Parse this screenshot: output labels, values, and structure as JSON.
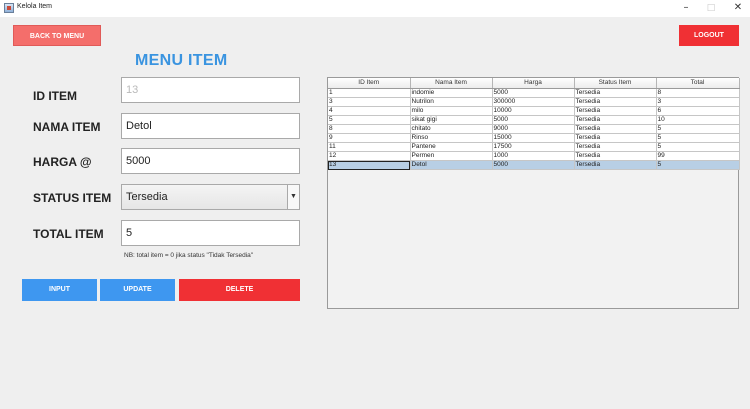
{
  "window": {
    "title": "Kelola Item"
  },
  "header": {
    "back_label": "BACK TO MENU",
    "logout_label": "LOGOUT",
    "page_title": "MENU ITEM"
  },
  "form": {
    "id_label": "ID ITEM",
    "id_value": "13",
    "name_label": "NAMA ITEM",
    "name_value": "Detol",
    "price_label": "HARGA @",
    "price_value": "5000",
    "status_label": "STATUS ITEM",
    "status_value": "Tersedia",
    "total_label": "TOTAL ITEM",
    "total_value": "5",
    "note": "NB: total item = 0 jika status \"Tidak Tersedia\""
  },
  "actions": {
    "input_label": "INPUT",
    "update_label": "UPDATE",
    "delete_label": "DELETE"
  },
  "table": {
    "columns": [
      "ID Item",
      "Nama Item",
      "Harga",
      "Status Item",
      "Total"
    ],
    "rows": [
      [
        "1",
        "indomie",
        "5000",
        "Tersedia",
        "8"
      ],
      [
        "3",
        "Nutrilon",
        "300000",
        "Tersedia",
        "3"
      ],
      [
        "4",
        "milo",
        "10000",
        "Tersedia",
        "6"
      ],
      [
        "5",
        "sikat gigi",
        "5000",
        "Tersedia",
        "10"
      ],
      [
        "8",
        "chitato",
        "9000",
        "Tersedia",
        "5"
      ],
      [
        "9",
        "Rinso",
        "15000",
        "Tersedia",
        "5"
      ],
      [
        "11",
        "Pantene",
        "17500",
        "Tersedia",
        "5"
      ],
      [
        "12",
        "Permen",
        "1000",
        "Tersedia",
        "99"
      ],
      [
        "13",
        "Detol",
        "5000",
        "Tersedia",
        "5"
      ]
    ],
    "selected_row": 8
  },
  "colors": {
    "accent_blue": "#3e97f0",
    "danger_red": "#f03034",
    "back_red": "#f46e6b",
    "title_blue": "#3a94e0",
    "selection": "#b8cfe5"
  }
}
